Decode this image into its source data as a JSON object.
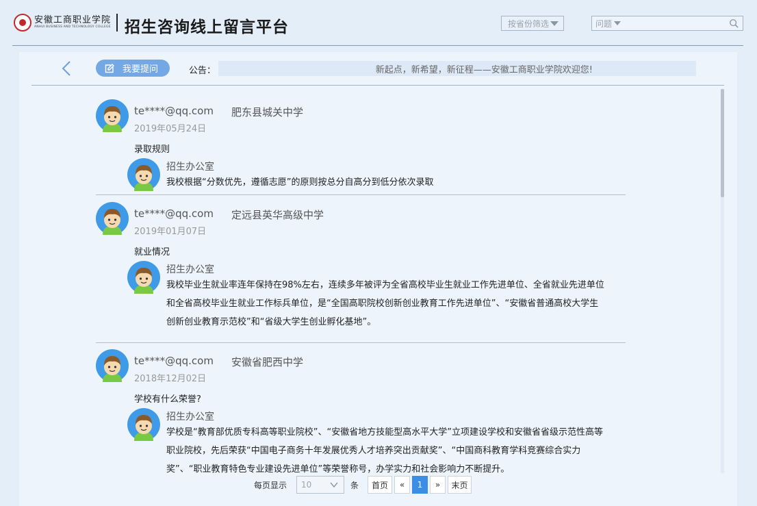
{
  "header": {
    "logo_cn": "安徽工商职业学院",
    "logo_en": "ANHUI BUSINESS AND TECHNOLOGY COLLEGE",
    "title": "招生咨询线上留言平台",
    "province_filter": "按省份筛选",
    "question_filter": "问题"
  },
  "toolbar": {
    "ask_label": "我要提问",
    "notice_label": "公告：",
    "notice_text": "新起点，新希望，新征程——安徽工商职业学院欢迎您!"
  },
  "posts": [
    {
      "user": "te****@qq.com",
      "school": "肥东县城关中学",
      "date": "2019年05月24日",
      "question": "录取规则",
      "answer_office": "招生办公室",
      "answer": "我校根据“分数优先，遵循志愿”的原则按总分自高分到低分依次录取"
    },
    {
      "user": "te****@qq.com",
      "school": "定远县英华高级中学",
      "date": "2019年01月07日",
      "question": "就业情况",
      "answer_office": "招生办公室",
      "answer": "我校毕业生就业率连年保持在98%左右，连续多年被评为全省高校毕业生就业工作先进单位、全省就业先进单位和全省高校毕业生就业工作标兵单位，是“全国高职院校创新创业教育工作先进单位”、“安徽省普通高校大学生创新创业教育示范校”和“省级大学生创业孵化基地”。"
    },
    {
      "user": "te****@qq.com",
      "school": "安徽省肥西中学",
      "date": "2018年12月02日",
      "question": "学校有什么荣誉?",
      "answer_office": "招生办公室",
      "answer": "学校是“教育部优质专科高等职业院校”、“安徽省地方技能型高水平大学”立项建设学校和安徽省省级示范性高等职业院校，先后荣获“中国电子商务十年发展优秀人才培养突出贡献奖”、“中国商科教育学科竞赛综合实力奖”、“职业教育特色专业建设先进单位”等荣誉称号，办学实力和社会影响力不断提升。"
    }
  ],
  "pagination": {
    "per_page_label": "每页显示",
    "page_size": "10",
    "unit_label": "条",
    "first": "首页",
    "prev": "«",
    "current": "1",
    "next": "»",
    "last": "末页"
  },
  "colors": {
    "accent": "#74a8e4",
    "active_page": "#3b8ee4",
    "background": "#e4eef9"
  }
}
